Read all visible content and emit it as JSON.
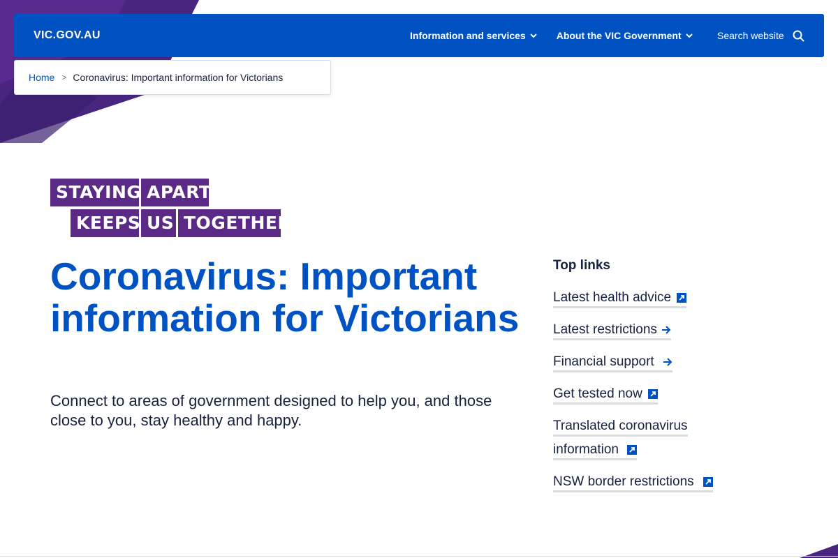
{
  "header": {
    "logo": "VIC.GOV.AU",
    "nav": [
      {
        "label": "Information and services"
      },
      {
        "label": "About the VIC Government"
      }
    ],
    "search_label": "Search website"
  },
  "breadcrumb": {
    "home": "Home",
    "separator": ">",
    "current": "Coronavirus: Important information for Victorians"
  },
  "campaign_logo": {
    "words": [
      "STAYING",
      "APART",
      "KEEPS",
      "US",
      "TOGETHER"
    ]
  },
  "hero": {
    "title": "Coronavirus: Important information for Victorians",
    "subtitle": "Connect to areas of government designed to help you, and those close to you, stay healthy and happy."
  },
  "top_links": {
    "heading": "Top links",
    "items": [
      {
        "label": "Latest health advice",
        "icon": "external-link-icon"
      },
      {
        "label": "Latest restrictions",
        "icon": "arrow-right-icon"
      },
      {
        "label": "Financial support",
        "icon": "arrow-right-icon"
      },
      {
        "label": "Get tested now",
        "icon": "external-link-icon"
      },
      {
        "label_line1": "Translated coronavirus",
        "label_line2": "information",
        "icon": "external-link-icon"
      },
      {
        "label": "NSW border restrictions",
        "icon": "external-link-icon"
      }
    ]
  },
  "colors": {
    "brand_blue": "#0052c2",
    "campaign_purple": "#5b2a86",
    "text_dark": "#16213d"
  }
}
